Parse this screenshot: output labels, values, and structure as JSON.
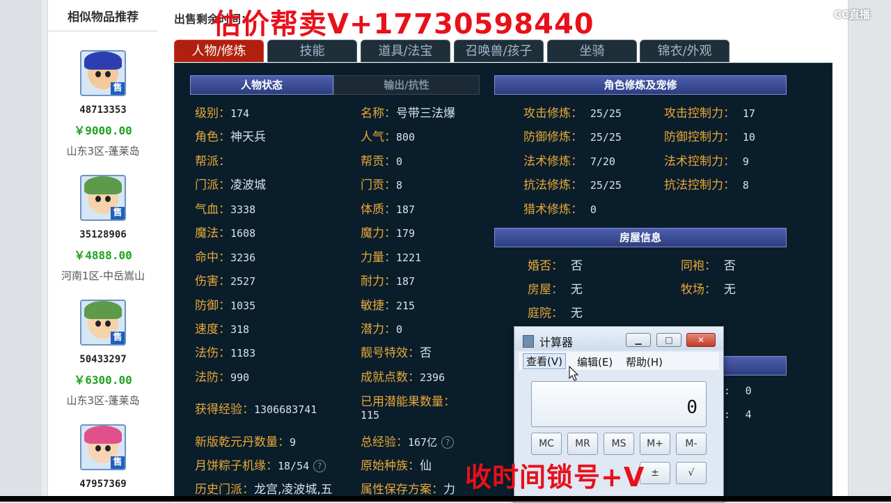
{
  "similar": {
    "title": "相似物品推荐",
    "items": [
      {
        "id": "48713353",
        "price": "￥9000.00",
        "server": "山东3区-蓬莱岛",
        "badge": "售",
        "hair": "#2d3fb0",
        "skin": "#f5c89c"
      },
      {
        "id": "35128906",
        "price": "￥4888.00",
        "server": "河南1区-中岳嵩山",
        "badge": "售",
        "hair": "#5d9a4a",
        "skin": "#f7d3a9"
      },
      {
        "id": "50433297",
        "price": "￥6300.00",
        "server": "山东3区-蓬莱岛",
        "badge": "售",
        "hair": "#5d9a4a",
        "skin": "#f7d3a9"
      },
      {
        "id": "47957369",
        "price": "",
        "server": "",
        "badge": "售",
        "hair": "#e0508a",
        "skin": "#f9d4b4"
      }
    ]
  },
  "header": {
    "sale_time": "出售剩余时间：",
    "watermark_top": "估价帮卖V+17730598440",
    "watermark_bottom": "收时间锁号+V",
    "logo": "CC直播"
  },
  "tabs": [
    {
      "label": "人物/修炼",
      "active": true
    },
    {
      "label": "技能",
      "active": false
    },
    {
      "label": "道具/法宝",
      "active": false
    },
    {
      "label": "召唤兽/孩子",
      "active": false
    },
    {
      "label": "坐骑",
      "active": false
    },
    {
      "label": "锦衣/外观",
      "active": false
    }
  ],
  "status_section": {
    "title": "人物状态",
    "title_inactive": "输出/抗性",
    "left": [
      {
        "k": "级别：",
        "v": "174"
      },
      {
        "k": "角色：",
        "v": "神天兵"
      },
      {
        "k": "帮派：",
        "v": ""
      },
      {
        "k": "门派：",
        "v": "凌波城"
      },
      {
        "k": "气血：",
        "v": "3338"
      },
      {
        "k": "魔法：",
        "v": "1608"
      },
      {
        "k": "命中：",
        "v": "3236"
      },
      {
        "k": "伤害：",
        "v": "2527"
      },
      {
        "k": "防御：",
        "v": "1035"
      },
      {
        "k": "速度：",
        "v": "318"
      },
      {
        "k": "法伤：",
        "v": "1183"
      },
      {
        "k": "法防：",
        "v": "990"
      }
    ],
    "right": [
      {
        "k": "名称：",
        "v": "号带三法爆"
      },
      {
        "k": "人气：",
        "v": "800"
      },
      {
        "k": "帮贡：",
        "v": "0"
      },
      {
        "k": "门贡：",
        "v": "8"
      },
      {
        "k": "体质：",
        "v": "187"
      },
      {
        "k": "魔力：",
        "v": "179"
      },
      {
        "k": "力量：",
        "v": "1221"
      },
      {
        "k": "耐力：",
        "v": "187"
      },
      {
        "k": "敏捷：",
        "v": "215"
      },
      {
        "k": "潜力：",
        "v": "0"
      },
      {
        "k": "靓号特效：",
        "v": "否"
      },
      {
        "k": "成就点数：",
        "v": "2396"
      }
    ],
    "extra": {
      "exp_k": "获得经验：",
      "exp_v": "1306683741",
      "potion_k": "已用潜能果数量：",
      "potion_v": "115",
      "qianyuan_k": "新版乾元丹数量：",
      "qianyuan_v": "9",
      "total_exp_k": "总经验：",
      "total_exp_v": "167亿",
      "mooncake_k": "月饼粽子机缘：",
      "mooncake_v": "18/54",
      "race_k": "原始种族：",
      "race_v": "仙",
      "history_k": "历史门派：",
      "history_v": "龙宫,凌波城,五",
      "save_k": "属性保存方案：",
      "save_v": "力",
      "qmark": "?"
    }
  },
  "cultivation": {
    "title": "角色修炼及宠修",
    "left": [
      {
        "k": "攻击修炼：",
        "v": "25/25"
      },
      {
        "k": "防御修炼：",
        "v": "25/25"
      },
      {
        "k": "法术修炼：",
        "v": "7/20"
      },
      {
        "k": "抗法修炼：",
        "v": "25/25"
      },
      {
        "k": "猎术修炼：",
        "v": "0"
      }
    ],
    "right": [
      {
        "k": "攻击控制力：",
        "v": "17"
      },
      {
        "k": "防御控制力：",
        "v": "10"
      },
      {
        "k": "法术控制力：",
        "v": "9"
      },
      {
        "k": "抗法控制力：",
        "v": "8"
      }
    ]
  },
  "house": {
    "title": "房屋信息",
    "marry_k": "婚否：",
    "marry_v": "否",
    "sworn_k": "同袍：",
    "sworn_v": "否",
    "house_k": "房屋：",
    "house_v": "无",
    "ranch_k": "牧场：",
    "ranch_v": "无",
    "yard_k": "庭院：",
    "yard_v": "无",
    "hidden1": "0",
    "hidden2": "4"
  },
  "calculator": {
    "title": "计算器",
    "menu_view": "查看(V)",
    "menu_edit": "编辑(E)",
    "menu_help": "帮助(H)",
    "display": "0",
    "keys_row1": [
      "MC",
      "MR",
      "MS",
      "M+",
      "M-"
    ],
    "key_pm": "±",
    "key_sqrt": "√"
  }
}
